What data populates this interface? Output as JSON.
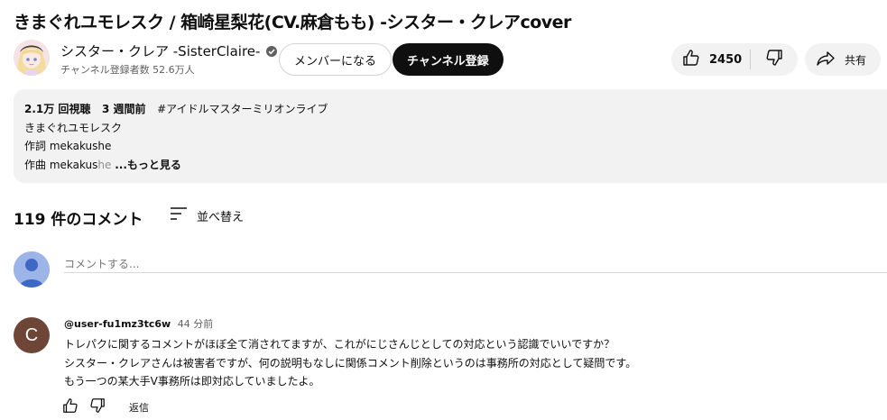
{
  "video": {
    "title": "きまぐれユモレスク / 箱崎星梨花(CV.麻倉もも) -シスター・クレアcover"
  },
  "channel": {
    "name": "シスター・クレア -SisterClaire-",
    "subscribers": "チャンネル登録者数 52.6万人",
    "verified_icon": "verified-check-icon"
  },
  "actions": {
    "member_label": "メンバーになる",
    "subscribe_label": "チャンネル登録",
    "like_count": "2450",
    "share_label": "共有"
  },
  "description": {
    "views": "2.1万 回視聴",
    "age": "3 週間前",
    "hashtag": "#アイドルマスターミリオンライブ",
    "line1": "きまぐれユモレスク",
    "line2": "作詞 mekakushe",
    "line3_visible": "作曲 mekakus",
    "line3_faded": "he",
    "more_label": "...もっと見る"
  },
  "comments": {
    "count_label": "119 件のコメント",
    "sort_label": "並べ替え",
    "input_placeholder": "コメントする...",
    "items": [
      {
        "avatar_letter": "C",
        "avatar_color": "#6d4637",
        "user": "@user-fu1mz3tc6w",
        "time": "44 分前",
        "lines": [
          "トレパクに関するコメントがほぼ全て消されてますが、これがにじさんじとしての対応という認識でいいですか？",
          "シスター・クレアさんは被害者ですが、何の説明もなしに関係コメント削除というのは事務所の対応として疑問です。",
          "もう一つの某大手V事務所は即対応していましたよ。"
        ],
        "reply_label": "返信"
      }
    ]
  },
  "colors": {
    "subscribe_bg": "#0f0f0f",
    "chip_bg": "#f2f2f2",
    "desc_bg": "#f2f2f2",
    "muted_text": "#606060"
  }
}
